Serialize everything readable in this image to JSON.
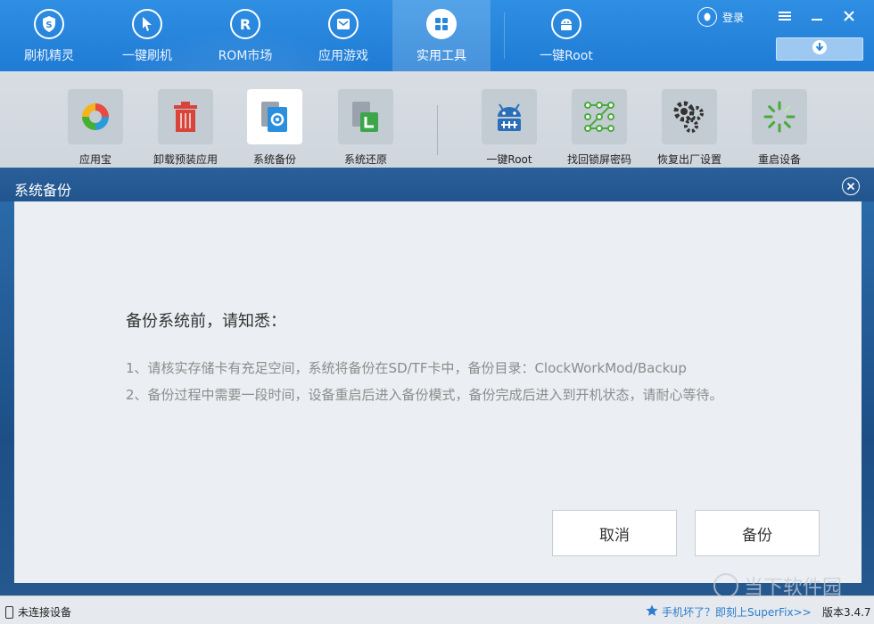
{
  "nav": {
    "tabs": [
      {
        "label": "刷机精灵",
        "icon": "shield-s-icon"
      },
      {
        "label": "一键刷机",
        "icon": "cursor-arrow-icon"
      },
      {
        "label": "ROM市场",
        "icon": "rom-r-icon"
      },
      {
        "label": "应用游戏",
        "icon": "mail-box-icon"
      },
      {
        "label": "实用工具",
        "icon": "grid-tools-icon",
        "active": true
      },
      {
        "label": "一键Root",
        "icon": "android-robot-icon"
      }
    ],
    "login_label": "登录"
  },
  "toolbar": {
    "tools": [
      {
        "label": "应用宝",
        "icon": "app-store-icon"
      },
      {
        "label": "卸载预装应用",
        "icon": "trash-icon"
      },
      {
        "label": "系统备份",
        "icon": "system-backup-icon",
        "active": true
      },
      {
        "label": "系统还原",
        "icon": "system-restore-icon"
      },
      {
        "label": "一键Root",
        "icon": "android-root-icon"
      },
      {
        "label": "找回锁屏密码",
        "icon": "pattern-lock-icon"
      },
      {
        "label": "恢复出厂设置",
        "icon": "gears-icon"
      },
      {
        "label": "重启设备",
        "icon": "loading-restart-icon"
      }
    ]
  },
  "dialog": {
    "title": "系统备份",
    "heading": "备份系统前，请知悉：",
    "line1": "1、请核实存储卡有充足空间，系统将备份在SD/TF卡中，备份目录：ClockWorkMod/Backup",
    "line2": "2、备份过程中需要一段时间，设备重启后进入备份模式，备份完成后进入到开机状态，请耐心等待。",
    "cancel_label": "取消",
    "backup_label": "备份"
  },
  "watermark": "当下软件园",
  "status": {
    "device": "未连接设备",
    "superfix": "手机坏了？即刻上SuperFix>>",
    "version": "版本3.4.7"
  },
  "colors": {
    "nav_blue": "#2a88dc",
    "dialog_header": "#255a93",
    "link_blue": "#2a7dd0"
  }
}
